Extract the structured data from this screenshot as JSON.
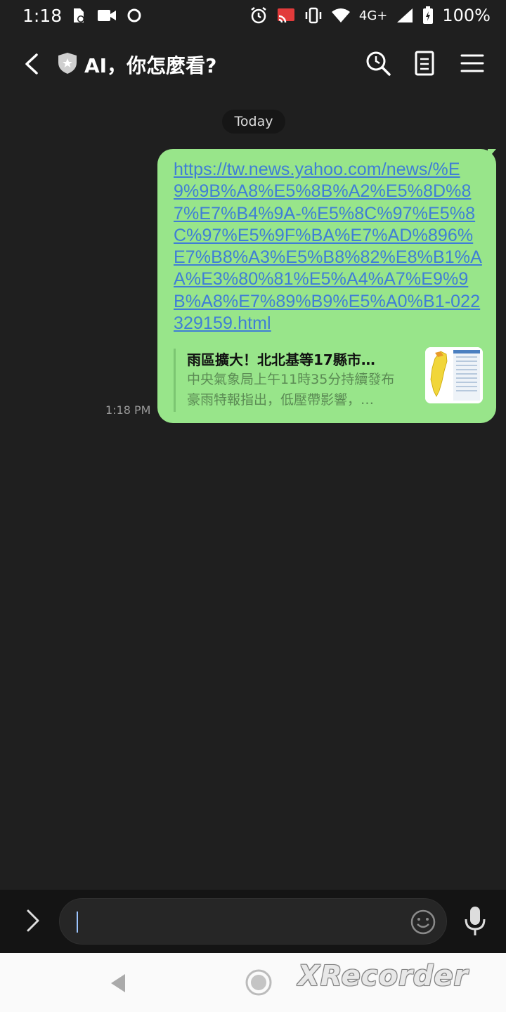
{
  "status_bar": {
    "time": "1:18",
    "network": "4G+",
    "battery": "100%"
  },
  "header": {
    "title": "AI，你怎麼看?"
  },
  "chat": {
    "date_label": "Today",
    "messages": [
      {
        "time": "1:18 PM",
        "link": "https://tw.news.yahoo.com/news/%E9%9B%A8%E5%8B%A2%E5%8D%87%E7%B4%9A-%E5%8C%97%E5%8C%97%E5%9F%BA%E7%AD%896%E7%B8%A3%E5%B8%82%E8%B1%AA%E3%80%81%E5%A4%A7%E9%9B%A8%E7%89%B9%E5%A0%B1-022329159.html",
        "preview": {
          "title": "雨區擴大！北北基等17縣市…",
          "description": "中央氣象局上午11時35分持續發布豪雨特報指出，低壓帶影響，…"
        }
      }
    ]
  },
  "input": {
    "placeholder": ""
  },
  "watermark": "XRecorder",
  "colors": {
    "background": "#1f1f1f",
    "bubble": "#98e58a",
    "link": "#3f7ed6"
  }
}
